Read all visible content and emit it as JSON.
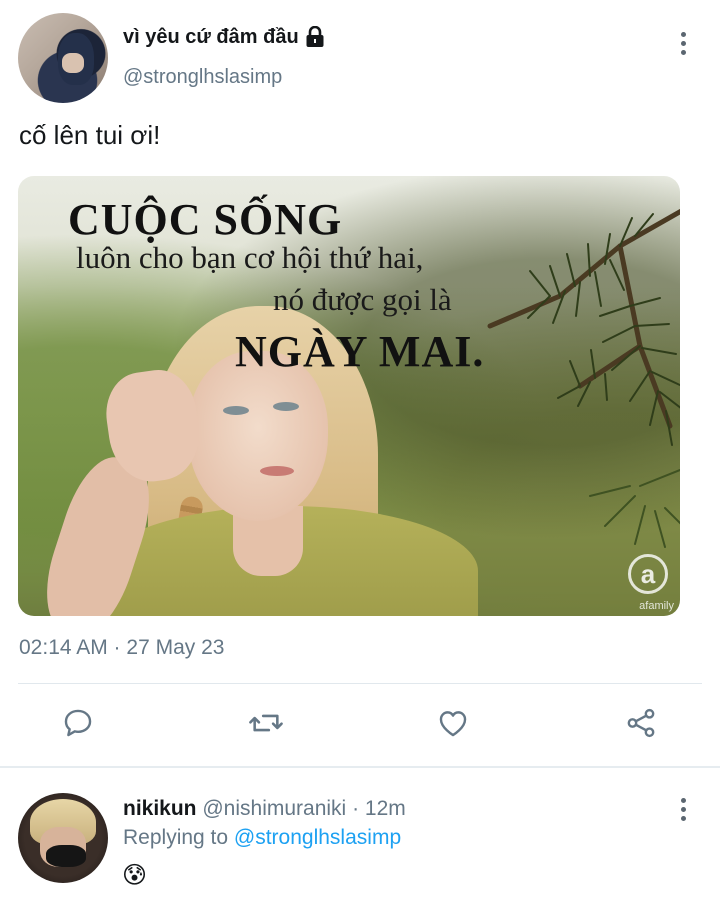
{
  "tweet": {
    "display_name": "vì yêu cứ đâm đầu",
    "handle": "@stronglhslasimp",
    "text": "cố lên tui ơi!",
    "timestamp": "02:14 AM · 27 May 23",
    "icons": {
      "lock": "lock-icon",
      "more": "more-vertical-icon",
      "reply": "comment-icon",
      "retweet": "retweet-icon",
      "like": "heart-icon",
      "share": "share-icon"
    },
    "image": {
      "quote_line1": "CUỘC SỐNG",
      "quote_line2": "luôn cho bạn cơ hội thứ hai,",
      "quote_line3": "nó được gọi là",
      "quote_line4": "NGÀY MAI.",
      "watermark_text": "afamily"
    }
  },
  "reply": {
    "name": "nikikun",
    "handle": "@nishimuraniki",
    "time": "· 12m",
    "replying_to_prefix": "Replying to",
    "replying_to_handle": "@stronglhslasimp",
    "emoji": "😰"
  },
  "colors": {
    "secondary_text": "#657786",
    "link": "#1da1f2",
    "divider": "#e1e8ed"
  }
}
